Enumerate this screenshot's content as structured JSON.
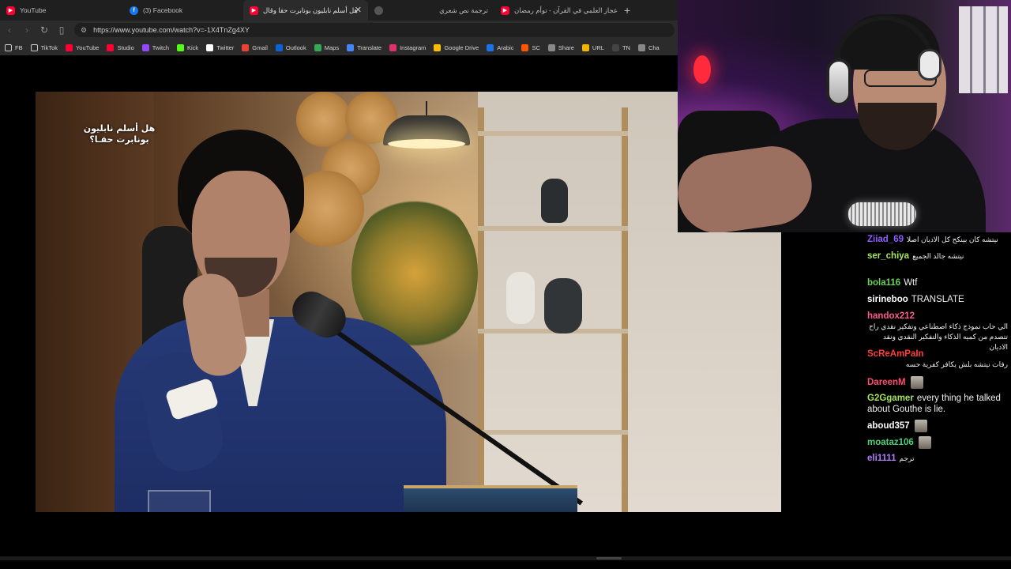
{
  "browser": {
    "tabs": [
      {
        "label": "YouTube",
        "icon": "youtube-icon",
        "active": false
      },
      {
        "label": "(3) Facebook",
        "icon": "facebook-icon",
        "active": false
      },
      {
        "label": "هل أسلم نابليون بونابرت حقا وقال",
        "icon": "youtube-icon",
        "active": true
      },
      {
        "label": "ترجمة نص شعري",
        "icon": "web-icon",
        "active": false
      },
      {
        "label": "الإعجاز العلمي في القرآن - توأم رمضان",
        "icon": "youtube-icon",
        "active": false
      }
    ],
    "close_glyph": "✕",
    "newtab_glyph": "+",
    "url": "https://www.youtube.com/watch?v=-1X4TnZg4XY",
    "bookmarks": [
      {
        "label": "FB",
        "icon": "folder-icon",
        "color": "#cccccc"
      },
      {
        "label": "TikTok",
        "icon": "folder-icon",
        "color": "#cccccc"
      },
      {
        "label": "YouTube",
        "icon": "youtube-icon",
        "color": "#ff0033"
      },
      {
        "label": "Studio",
        "icon": "studio-icon",
        "color": "#ff0033"
      },
      {
        "label": "Twitch",
        "icon": "twitch-icon",
        "color": "#9146ff"
      },
      {
        "label": "Kick",
        "icon": "kick-icon",
        "color": "#53fc18"
      },
      {
        "label": "Twitter",
        "icon": "x-icon",
        "color": "#ffffff"
      },
      {
        "label": "Gmail",
        "icon": "gmail-icon",
        "color": "#ea4335"
      },
      {
        "label": "Outlook",
        "icon": "outlook-icon",
        "color": "#0a64d6"
      },
      {
        "label": "Maps",
        "icon": "maps-icon",
        "color": "#34a853"
      },
      {
        "label": "Translate",
        "icon": "translate-icon",
        "color": "#4285f4"
      },
      {
        "label": "Instagram",
        "icon": "instagram-icon",
        "color": "#e1306c"
      },
      {
        "label": "Google Drive",
        "icon": "drive-icon",
        "color": "#fbbc04"
      },
      {
        "label": "Arabic",
        "icon": "arabic-icon",
        "color": "#1a73e8"
      },
      {
        "label": "SC",
        "icon": "sc-icon",
        "color": "#ff5500"
      },
      {
        "label": "Share",
        "icon": "share-icon",
        "color": "#888888"
      },
      {
        "label": "URL",
        "icon": "url-icon",
        "color": "#f4b400"
      },
      {
        "label": "TN",
        "icon": "tn-icon",
        "color": "#444444"
      },
      {
        "label": "Cha",
        "icon": "chat-icon",
        "color": "#888888"
      }
    ]
  },
  "video": {
    "caption": "هل أسلم نابليون بونابرت حقـا؟"
  },
  "chat": {
    "messages": [
      {
        "name": "Ziiad_69",
        "color": "#8f5cff",
        "text": "نيتشه كان بينكح كل الاديان اصلا",
        "rtl": true,
        "block": false
      },
      {
        "name": "ser_chiya",
        "color": "#a8e65c",
        "text": "نيتشه جالد الجميع",
        "rtl": true,
        "block": false
      },
      {
        "name": "bola116",
        "color": "#6ad25a",
        "text": "Wtf",
        "rtl": false,
        "block": false
      },
      {
        "name": "sirineboo",
        "color": "#ffffff",
        "text": "TRANSLATE",
        "rtl": false,
        "block": false
      },
      {
        "name": "handox212",
        "color": "#ff5a8a",
        "text": "الي حاب نموذج ذكاء اصطناعي وتفكير نقدي راح تتصدم من كميه الذكاء والتفكير النقدي ونقد الاديان",
        "rtl": true,
        "block": true
      },
      {
        "name": "ScReAmPaIn",
        "color": "#ff3b3b",
        "text": "رفات نيتشه بلش يكافر كفرية حسه",
        "rtl": true,
        "block": true
      },
      {
        "name": "DareenM",
        "color": "#ff4d6a",
        "text": "",
        "rtl": false,
        "block": false,
        "avatar": true
      },
      {
        "name": "G2Ggamer",
        "color": "#a4e35a",
        "text": "every thing he talked about Gouthe is lie.",
        "rtl": false,
        "block": false
      },
      {
        "name": "aboud357",
        "color": "#ffffff",
        "text": "",
        "rtl": false,
        "block": false,
        "avatar": true
      },
      {
        "name": "moataz106",
        "color": "#4cd37a",
        "text": "",
        "rtl": false,
        "block": false,
        "avatar": true
      },
      {
        "name": "eli1111",
        "color": "#b57bff",
        "text": "ترجم",
        "rtl": true,
        "block": false
      }
    ]
  }
}
